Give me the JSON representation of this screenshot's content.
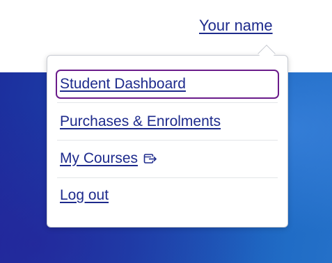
{
  "header": {
    "user_name": "Your name"
  },
  "menu": {
    "items": [
      {
        "label": "Student Dashboard",
        "focused": true
      },
      {
        "label": "Purchases & Enrolments"
      },
      {
        "label": "My Courses",
        "icon": "external-link-icon"
      },
      {
        "label": "Log out"
      }
    ]
  },
  "colors": {
    "link": "#1d2a8c",
    "focus_ring": "#6a1b8a",
    "background_blue": "#1a4cb0"
  }
}
